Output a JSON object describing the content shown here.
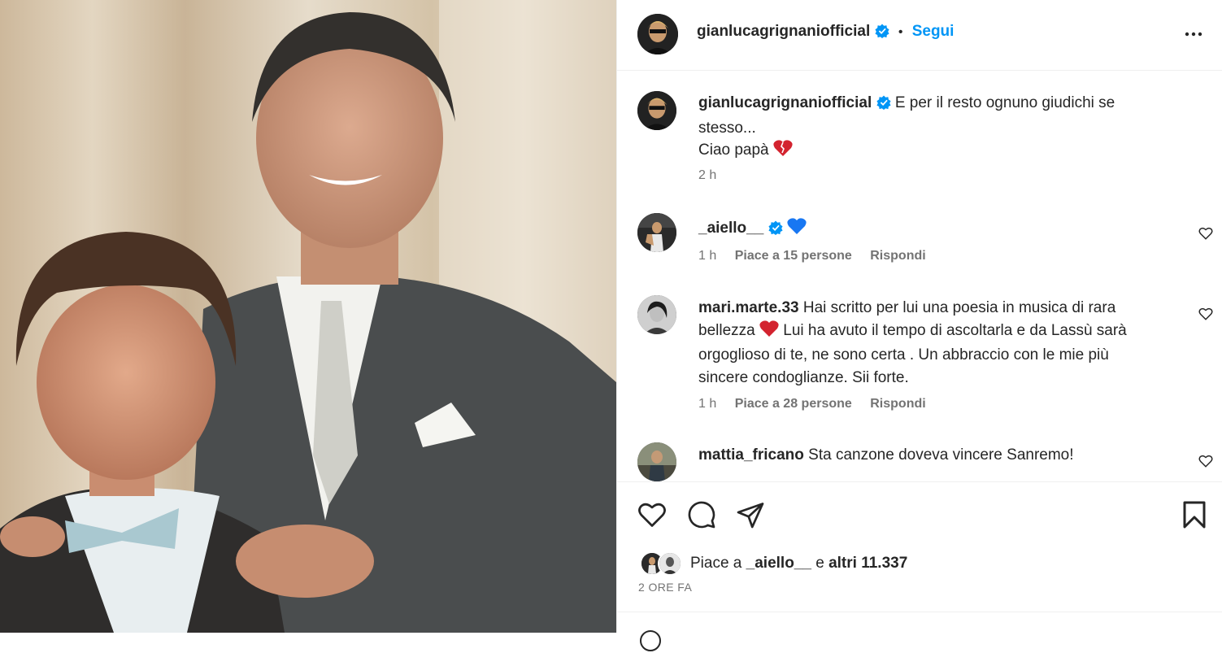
{
  "post": {
    "username": "gianlucagrignaniofficial",
    "follow_label": "Segui",
    "separator": "•",
    "caption_line1": "E per il resto ognuno giudichi se stesso...",
    "caption_line2": "Ciao papà",
    "caption_time": "2 h"
  },
  "comments": [
    {
      "username": "_aiello__",
      "text": "",
      "time": "1 h",
      "likes": "Piace a 15 persone",
      "reply": "Rispondi"
    },
    {
      "username": "mari.marte.33",
      "text_a": "Hai scritto per lui una poesia in musica di rara bellezza",
      "text_b": "Lui ha avuto il tempo di ascoltarla e da Lassù sarà orgoglioso di te, ne sono certa . Un abbraccio con le mie più sincere condoglianze. Sii forte.",
      "time": "1 h",
      "likes": "Piace a 28 persone",
      "reply": "Rispondi"
    },
    {
      "username": "mattia_fricano",
      "text": "Sta canzone doveva vincere Sanremo!"
    }
  ],
  "likes_bar": {
    "prefix": "Piace a",
    "liker": "_aiello__",
    "mid": "e",
    "others": "altri 11.337"
  },
  "date_label": "2 ORE FA",
  "colors": {
    "accent": "#0095f6",
    "verified": "#0095f6",
    "broken_heart": "#d3232f",
    "blue_heart": "#1877f2"
  }
}
